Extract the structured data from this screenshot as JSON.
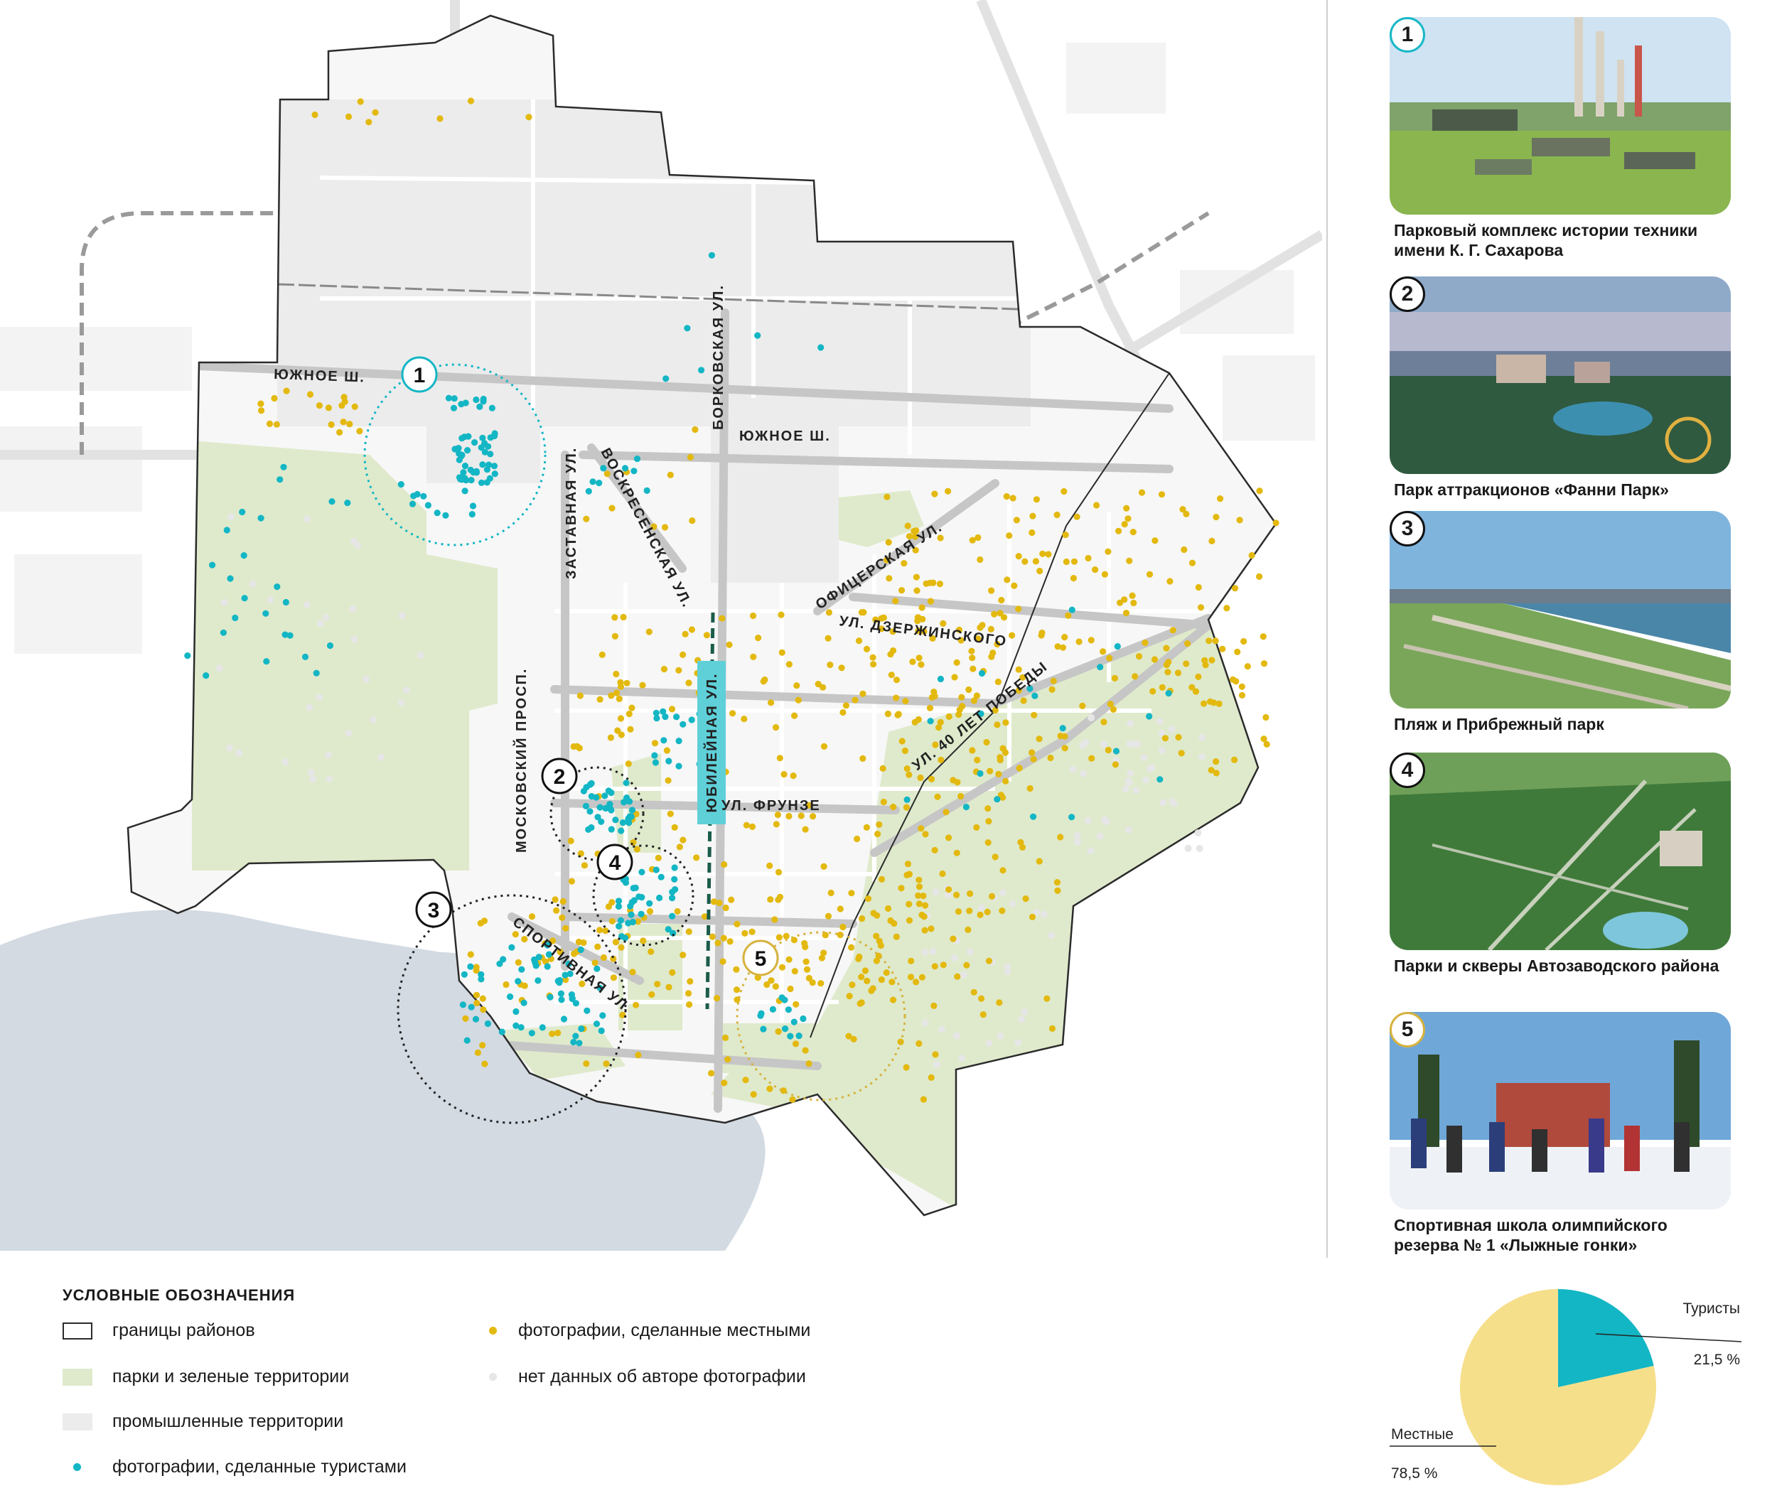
{
  "map": {
    "streets": {
      "yuzhnoe_w": "ЮЖНОЕ Ш.",
      "yuzhnoe_e": "ЮЖНОЕ Ш.",
      "borkovskaya": "БОРКОВСКАЯ УЛ.",
      "voskresenskaya": "ВОСКРЕСЕНСКАЯ УЛ.",
      "zastavnaya": "ЗАСТАВНАЯ УЛ.",
      "ofitserskaya": "ОФИЦЕРСКАЯ УЛ.",
      "dzerzhinskogo": "УЛ. ДЗЕРЖИНСКОГО",
      "pobedy": "УЛ. 40 ЛЕТ ПОБЕДЫ",
      "yubileynaya": "ЮБИЛЕЙНАЯ УЛ.",
      "frunze": "УЛ. ФРУНЗЕ",
      "moskovsky": "МОСКОВСКИЙ ПРОСП.",
      "sportivnaya": "СПОРТИВНАЯ УЛ."
    },
    "markers": [
      "1",
      "2",
      "3",
      "4",
      "5"
    ],
    "colors": {
      "tourist": "#13b6c4",
      "local": "#e3b90f",
      "unknown": "#e6e6e6",
      "park": "#dfeacc",
      "industrial": "#ececec",
      "water": "#d1d8df",
      "boundary": "#2b2b2b"
    }
  },
  "gallery": [
    {
      "num": "1",
      "caption": "Парковый комплекс истории техники имени К. Г. Сахарова"
    },
    {
      "num": "2",
      "caption": "Парк аттракционов «Фанни Парк»"
    },
    {
      "num": "3",
      "caption": "Пляж и Прибрежный парк"
    },
    {
      "num": "4",
      "caption": "Парки и скверы Автозаводского района"
    },
    {
      "num": "5",
      "caption": "Спортивная школа олимпийского резерва № 1 «Лыжные гонки»"
    }
  ],
  "legend": {
    "title": "УСЛОВНЫЕ ОБОЗНАЧЕНИЯ",
    "items": {
      "borders": "границы районов",
      "parks": "парки и зеленые территории",
      "industrial": "промышленные территории",
      "tourists": "фотографии, сделанные туристами",
      "locals": "фотографии, сделанные местными",
      "unknown": "нет данных об авторе фотографии"
    }
  },
  "chart_data": {
    "type": "pie",
    "categories": [
      "Туристы",
      "Местные"
    ],
    "values": [
      21.5,
      78.5
    ],
    "value_labels": [
      "21,5 %",
      "78,5 %"
    ],
    "colors": [
      "#13b6c4",
      "#f6df8a"
    ]
  }
}
